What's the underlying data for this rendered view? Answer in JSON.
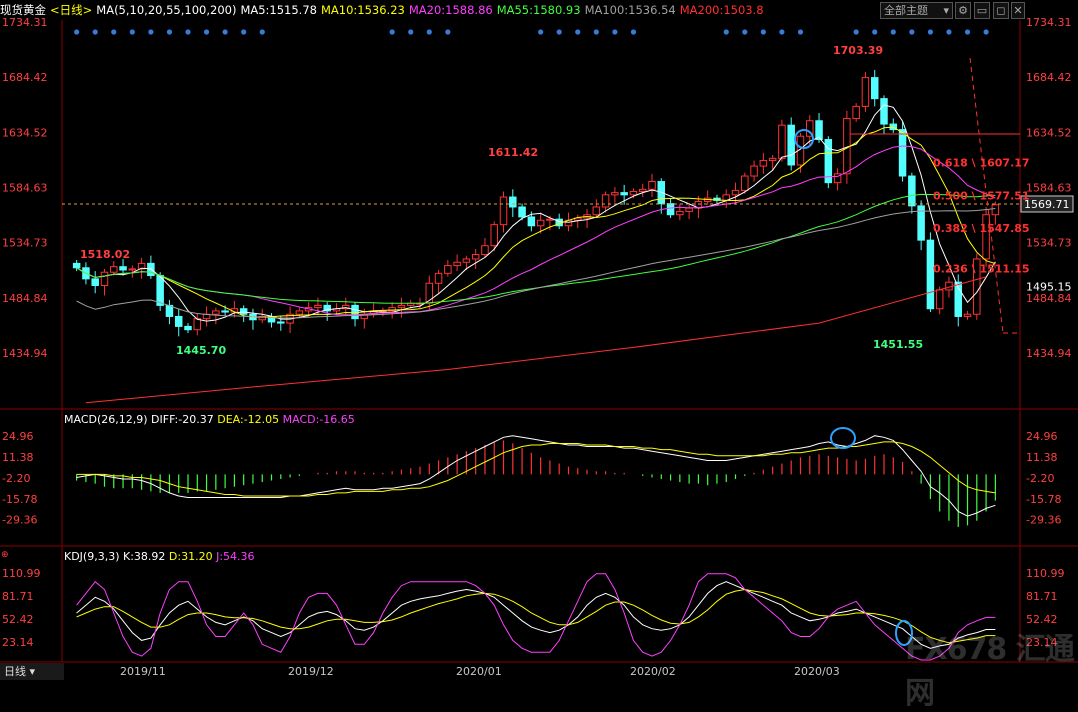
{
  "header": {
    "title": "现货黄金",
    "period": "<日线>",
    "ma_spec": "MA(5,10,20,55,100,200)",
    "ma_values": [
      {
        "label": "MA5:1515.78",
        "color": "#ffffff"
      },
      {
        "label": "MA10:1536.23",
        "color": "#ffff00"
      },
      {
        "label": "MA20:1588.86",
        "color": "#ff40ff"
      },
      {
        "label": "MA55:1580.93",
        "color": "#40ff40"
      },
      {
        "label": "MA100:1536.54",
        "color": "#a0a0a0"
      },
      {
        "label": "MA200:1503.8",
        "color": "#ff3030"
      }
    ],
    "selector": "全部主题",
    "bottom_tab": "日线"
  },
  "watermark": "FX678 汇通网",
  "colors": {
    "up": "#ff3232",
    "down": "#54ffff",
    "bg": "#000000",
    "axis": "#8b0000",
    "price_line": "#ffff00"
  },
  "chart_data": [
    {
      "type": "candlestick",
      "y_ticks": [
        "1734.31",
        "1684.42",
        "1634.52",
        "1584.63",
        "1534.73",
        "1484.84",
        "1434.94"
      ],
      "right_extra_ticks": [
        "1495.15"
      ],
      "ylim": [
        1434.94,
        1734.31
      ],
      "current_price": "1569.71",
      "x_labels": [
        "2019/11",
        "2019/12",
        "2020/01",
        "2020/02",
        "2020/03"
      ],
      "annotations": {
        "high1": "1518.02",
        "low1": "1445.70",
        "high2": "1611.42",
        "high3": "1703.39",
        "low3": "1451.55"
      },
      "fib_levels": [
        {
          "label": "0.618 \\ 1607.17",
          "value": 1607.17
        },
        {
          "label": "0.500 \\ 1577.51",
          "value": 1577.51
        },
        {
          "label": "0.382 \\ 1547.85",
          "value": 1547.85
        },
        {
          "label": "0.236 \\ 1511.15",
          "value": 1511.15
        }
      ],
      "closes": [
        1512,
        1502,
        1496,
        1508,
        1513,
        1510,
        1511,
        1516,
        1505,
        1478,
        1468,
        1459,
        1456,
        1466,
        1470,
        1473,
        1472,
        1475,
        1470,
        1465,
        1468,
        1463,
        1462,
        1470,
        1473,
        1476,
        1478,
        1473,
        1475,
        1478,
        1466,
        1470,
        1473,
        1473,
        1476,
        1478,
        1480,
        1480,
        1498,
        1507,
        1514,
        1517,
        1520,
        1524,
        1532,
        1551,
        1576,
        1567,
        1558,
        1550,
        1555,
        1556,
        1550,
        1555,
        1557,
        1560,
        1567,
        1578,
        1580,
        1578,
        1581,
        1583,
        1590,
        1570,
        1560,
        1563,
        1566,
        1572,
        1575,
        1573,
        1578,
        1582,
        1595,
        1604,
        1609,
        1611,
        1641,
        1605,
        1631,
        1645,
        1628,
        1589,
        1597,
        1647,
        1658,
        1684,
        1665,
        1642,
        1637,
        1595,
        1568,
        1537,
        1475,
        1492,
        1499,
        1468,
        1470,
        1520,
        1560,
        1569
      ],
      "ma200": [
        [
          1,
          1390
        ],
        [
          20,
          1405
        ],
        [
          40,
          1420
        ],
        [
          60,
          1440
        ],
        [
          80,
          1462
        ],
        [
          98,
          1503.8
        ]
      ],
      "macd": {
        "y_ticks": [
          "24.96",
          "11.38",
          "-2.20",
          "-15.78",
          "-29.36"
        ],
        "label": "MACD(26,12,9)",
        "diff": "DIFF:-20.37",
        "dea": "DEA:-12.05",
        "macd": "MACD:-16.65",
        "ylim": [
          -36,
          30
        ],
        "hist": [
          -4,
          -5,
          -6,
          -8,
          -9,
          -9,
          -9,
          -10,
          -11,
          -12,
          -12,
          -12,
          -12,
          -11,
          -11,
          -10,
          -9,
          -8,
          -7,
          -6,
          -5,
          -4,
          -3,
          -2,
          -1,
          0,
          1,
          1,
          2,
          2,
          2,
          1,
          1,
          1,
          2,
          3,
          4,
          5,
          7,
          9,
          11,
          13,
          15,
          17,
          19,
          21,
          22,
          20,
          17,
          14,
          11,
          9,
          7,
          5,
          4,
          3,
          2,
          2,
          1,
          1,
          0,
          -1,
          -2,
          -3,
          -4,
          -5,
          -6,
          -6,
          -7,
          -6,
          -5,
          -3,
          -1,
          1,
          3,
          5,
          7,
          9,
          11,
          12,
          13,
          12,
          11,
          10,
          9,
          10,
          12,
          13,
          11,
          8,
          2,
          -6,
          -16,
          -24,
          -30,
          -34,
          -33,
          -30,
          -24,
          -17
        ],
        "diff_line": [
          -2,
          -1,
          0,
          -1,
          -2,
          -3,
          -3,
          -4,
          -6,
          -9,
          -12,
          -14,
          -15,
          -15,
          -15,
          -15,
          -15,
          -15,
          -15,
          -15,
          -15,
          -15,
          -15,
          -14,
          -14,
          -13,
          -12,
          -11,
          -10,
          -9,
          -10,
          -10,
          -10,
          -9,
          -9,
          -8,
          -7,
          -6,
          -3,
          1,
          5,
          9,
          12,
          15,
          18,
          21,
          24,
          25,
          24,
          23,
          22,
          21,
          20,
          19,
          19,
          18,
          18,
          18,
          18,
          17,
          17,
          16,
          15,
          14,
          13,
          12,
          11,
          10,
          9,
          9,
          9,
          10,
          11,
          12,
          13,
          14,
          15,
          16,
          17,
          18,
          20,
          21,
          19,
          18,
          20,
          22,
          25,
          24,
          22,
          16,
          9,
          2,
          -8,
          -12,
          -17,
          -24,
          -27,
          -25,
          -22,
          -20
        ],
        "dea_line": [
          0,
          0,
          0,
          0,
          -1,
          -1,
          -2,
          -2,
          -3,
          -4,
          -6,
          -8,
          -9,
          -10,
          -11,
          -12,
          -13,
          -13,
          -14,
          -14,
          -14,
          -14,
          -14,
          -14,
          -14,
          -14,
          -13,
          -13,
          -12,
          -12,
          -11,
          -11,
          -11,
          -11,
          -10,
          -10,
          -9,
          -9,
          -8,
          -6,
          -4,
          -1,
          2,
          5,
          8,
          11,
          14,
          16,
          18,
          19,
          19,
          20,
          20,
          20,
          20,
          19,
          19,
          19,
          18,
          18,
          18,
          17,
          17,
          16,
          16,
          15,
          14,
          13,
          13,
          12,
          12,
          12,
          12,
          12,
          12,
          13,
          13,
          14,
          14,
          15,
          16,
          17,
          17,
          18,
          18,
          19,
          20,
          21,
          21,
          20,
          18,
          15,
          11,
          6,
          1,
          -4,
          -8,
          -10,
          -11,
          -12
        ]
      },
      "kdj": {
        "y_ticks": [
          "110.99",
          "81.71",
          "52.42",
          "23.14"
        ],
        "label": "KDJ(9,3,3)",
        "k": "K:38.92",
        "d": "D:31.20",
        "j": "J:54.36",
        "ylim": [
          0,
          120
        ],
        "k_line": [
          60,
          70,
          80,
          75,
          65,
          50,
          35,
          25,
          28,
          45,
          60,
          70,
          75,
          65,
          55,
          48,
          45,
          50,
          55,
          50,
          40,
          35,
          30,
          35,
          45,
          55,
          60,
          62,
          58,
          50,
          40,
          38,
          42,
          50,
          60,
          70,
          75,
          78,
          80,
          82,
          85,
          88,
          90,
          88,
          85,
          80,
          70,
          60,
          50,
          42,
          38,
          35,
          38,
          45,
          55,
          70,
          80,
          85,
          80,
          70,
          55,
          45,
          40,
          38,
          40,
          45,
          55,
          70,
          85,
          95,
          100,
          95,
          90,
          85,
          80,
          75,
          70,
          60,
          55,
          50,
          52,
          55,
          60,
          62,
          65,
          60,
          55,
          50,
          45,
          40,
          30,
          20,
          15,
          18,
          20,
          28,
          32,
          35,
          38.9,
          38.9
        ],
        "d_line": [
          55,
          60,
          65,
          68,
          68,
          62,
          55,
          48,
          42,
          42,
          45,
          52,
          58,
          60,
          60,
          58,
          55,
          54,
          54,
          53,
          50,
          46,
          42,
          40,
          40,
          42,
          46,
          50,
          52,
          52,
          50,
          48,
          48,
          49,
          51,
          55,
          60,
          64,
          68,
          72,
          75,
          78,
          82,
          84,
          85,
          84,
          80,
          75,
          68,
          60,
          54,
          48,
          45,
          45,
          48,
          55,
          62,
          70,
          74,
          74,
          70,
          64,
          57,
          51,
          47,
          46,
          48,
          55,
          64,
          75,
          84,
          88,
          90,
          88,
          86,
          82,
          78,
          72,
          66,
          60,
          57,
          56,
          57,
          58,
          60,
          60,
          59,
          57,
          54,
          50,
          44,
          36,
          29,
          25,
          22,
          24,
          26,
          28,
          31.2,
          31.2
        ],
        "j_line": [
          70,
          85,
          100,
          90,
          60,
          30,
          10,
          5,
          15,
          60,
          90,
          100,
          100,
          75,
          45,
          30,
          30,
          45,
          60,
          45,
          20,
          15,
          10,
          30,
          60,
          80,
          85,
          85,
          70,
          45,
          20,
          20,
          35,
          60,
          80,
          95,
          100,
          100,
          100,
          100,
          100,
          100,
          100,
          95,
          85,
          70,
          45,
          25,
          15,
          10,
          10,
          10,
          25,
          50,
          75,
          100,
          110,
          110,
          90,
          60,
          25,
          10,
          5,
          10,
          25,
          45,
          70,
          100,
          110,
          110,
          110,
          105,
          90,
          80,
          70,
          60,
          50,
          35,
          30,
          30,
          40,
          55,
          65,
          70,
          75,
          60,
          45,
          35,
          25,
          15,
          5,
          0,
          0,
          5,
          15,
          35,
          45,
          50,
          54.4,
          54.4
        ]
      }
    }
  ]
}
